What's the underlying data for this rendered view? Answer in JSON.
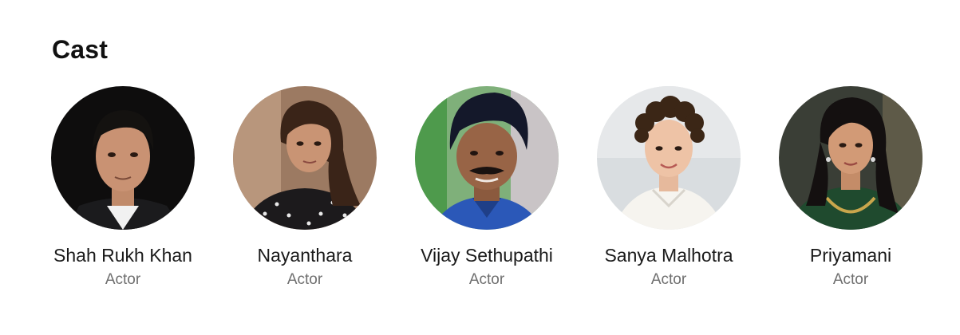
{
  "section": {
    "title": "Cast"
  },
  "cast": [
    {
      "name": "Shah Rukh Khan",
      "role": "Actor",
      "photo_icon": "portrait-shah-rukh-khan-icon"
    },
    {
      "name": "Nayanthara",
      "role": "Actor",
      "photo_icon": "portrait-nayanthara-icon"
    },
    {
      "name": "Vijay Sethupathi",
      "role": "Actor",
      "photo_icon": "portrait-vijay-sethupathi-icon"
    },
    {
      "name": "Sanya Malhotra",
      "role": "Actor",
      "photo_icon": "portrait-sanya-malhotra-icon"
    },
    {
      "name": "Priyamani",
      "role": "Actor",
      "photo_icon": "portrait-priyamani-icon"
    }
  ]
}
